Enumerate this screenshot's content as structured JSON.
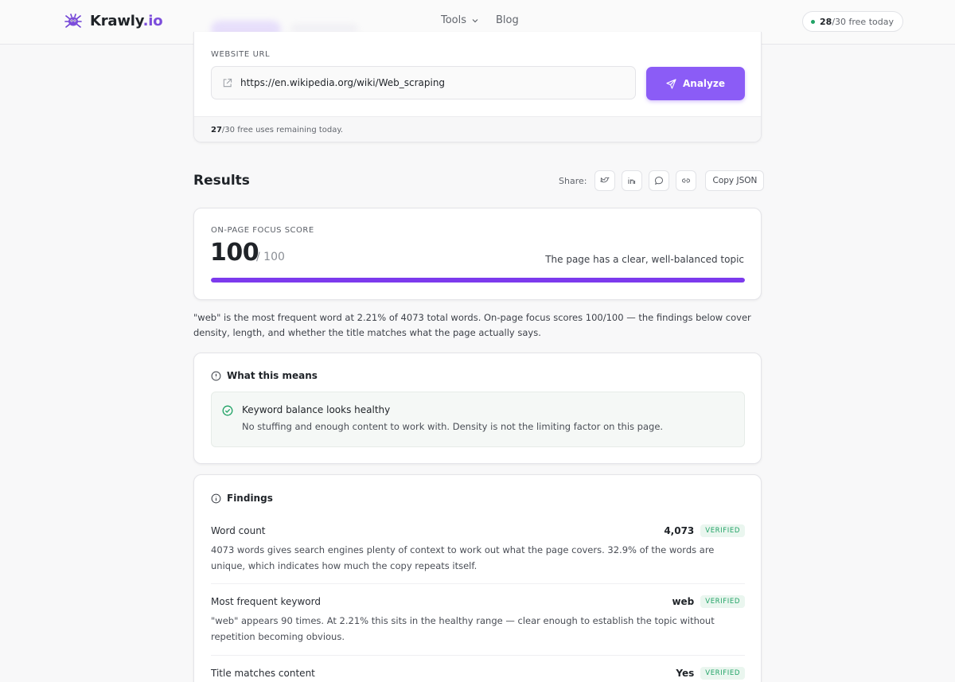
{
  "brand": {
    "name_main": "Krawly",
    "name_accent": ".io",
    "logo": "spider-logo"
  },
  "nav": {
    "tools": "Tools",
    "blog": "Blog"
  },
  "quota_pill": {
    "used": "28",
    "rest": "/30 free today"
  },
  "url_form": {
    "label": "WEBSITE URL",
    "value": "https://en.wikipedia.org/wiki/Web_scraping",
    "button": "Analyze",
    "remaining_count": "27",
    "remaining_text": "/30 free uses remaining today."
  },
  "results": {
    "title": "Results",
    "share_label": "Share:",
    "share_icons": [
      "twitter-icon",
      "linkedin-icon",
      "message-icon",
      "link-icon"
    ],
    "copy_json": "Copy JSON"
  },
  "score": {
    "label": "ON-PAGE FOCUS SCORE",
    "value": "100",
    "max": "/ 100",
    "description": "The page has a clear, well-balanced topic",
    "percent": 100
  },
  "summary": "\"web\" is the most frequent word at 2.21% of 4073 total words. On-page focus scores 100/100 — the findings below cover density, length, and whether the title matches what the page actually says.",
  "means": {
    "heading": "What this means",
    "title": "Keyword balance looks healthy",
    "text": "No stuffing and enough content to work with. Density is not the limiting factor on this page."
  },
  "findings": {
    "heading": "Findings",
    "items": [
      {
        "name": "Word count",
        "value": "4,073",
        "badge": "VERIFIED",
        "desc": "4073 words gives search engines plenty of context to work out what the page covers. 32.9% of the words are unique, which indicates how much the copy repeats itself."
      },
      {
        "name": "Most frequent keyword",
        "value": "web",
        "badge": "VERIFIED",
        "desc": "\"web\" appears 90 times. At 2.21% this sits in the healthy range — clear enough to establish the topic without repetition becoming obvious."
      },
      {
        "name": "Title matches content",
        "value": "Yes",
        "badge": "VERIFIED",
        "desc": ""
      }
    ]
  },
  "colors": {
    "accent": "#8b5cf6",
    "score_bar": "#7c3aed",
    "verified": "#21a366"
  }
}
